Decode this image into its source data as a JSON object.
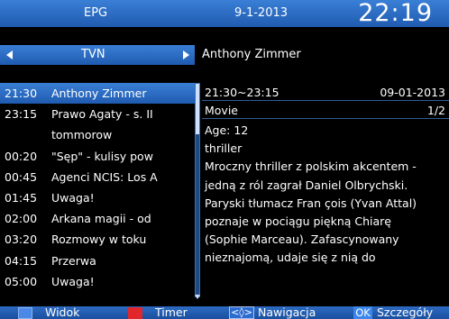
{
  "header": {
    "title": "EPG",
    "date": "9-1-2013",
    "time": "22:19"
  },
  "channel": {
    "name": "TVN",
    "selected_program_title": "Anthony Zimmer"
  },
  "program_list": [
    {
      "time": "21:30",
      "title": "Anthony Zimmer",
      "selected": true
    },
    {
      "time": "23:15",
      "title": "Prawo Agaty - s. II",
      "selected": false
    },
    {
      "time": "",
      "title": "tommorow",
      "selected": false
    },
    {
      "time": "00:20",
      "title": "\"Sęp\" - kulisy pow",
      "selected": false
    },
    {
      "time": "00:45",
      "title": "Agenci NCIS: Los A",
      "selected": false
    },
    {
      "time": "01:45",
      "title": "Uwaga!",
      "selected": false
    },
    {
      "time": "02:00",
      "title": "Arkana magii - od",
      "selected": false
    },
    {
      "time": "03:20",
      "title": "Rozmowy w toku",
      "selected": false
    },
    {
      "time": "04:15",
      "title": "Przerwa",
      "selected": false
    },
    {
      "time": "05:00",
      "title": "Uwaga!",
      "selected": false
    }
  ],
  "details": {
    "time_range": "21:30~23:15",
    "air_date": "09-01-2013",
    "category": "Movie",
    "page": "1/2",
    "age": "Age: 12",
    "genre": "thriller",
    "description": [
      "Mroczny thriller z polskim akcentem -",
      "jedną z ról zagrał Daniel Olbrychski.",
      "Paryski tłumacz Fran çois (Yvan Attal)",
      "poznaje w pociągu piękną Chiarę",
      "(Sophie Marceau). Zafascynowany",
      "nieznajomą, udaje się z nią do"
    ]
  },
  "footer": {
    "view_label": "Widok",
    "timer_label": "Timer",
    "nav_key": "<◊>",
    "nav_label": "Nawigacja",
    "ok_key": "OK",
    "details_label": "Szczegóły"
  },
  "colors": {
    "bar_blue": "#2c6bc2",
    "blue_key": "#4c89e6",
    "red_key": "#e2262c"
  }
}
